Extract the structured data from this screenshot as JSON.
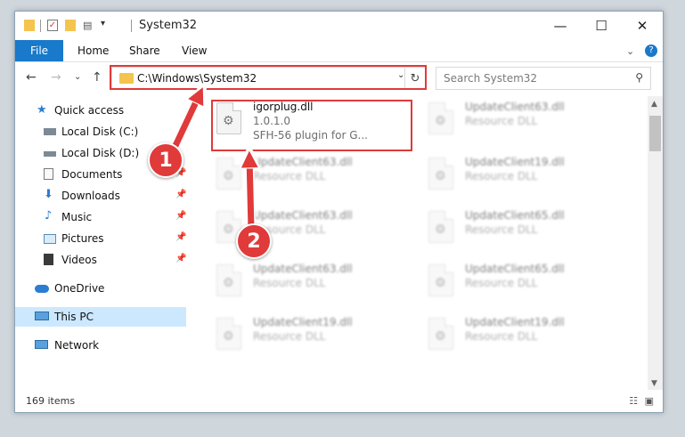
{
  "window": {
    "title": "System32"
  },
  "ribbon": {
    "file": "File",
    "home": "Home",
    "share": "Share",
    "view": "View"
  },
  "nav": {
    "address": "C:\\Windows\\System32",
    "search_placeholder": "Search System32"
  },
  "sidebar": {
    "items": [
      {
        "label": "Quick access"
      },
      {
        "label": "Local Disk (C:)"
      },
      {
        "label": "Local Disk (D:)"
      },
      {
        "label": "Documents"
      },
      {
        "label": "Downloads"
      },
      {
        "label": "Music"
      },
      {
        "label": "Pictures"
      },
      {
        "label": "Videos"
      },
      {
        "label": "OneDrive"
      },
      {
        "label": "This PC"
      },
      {
        "label": "Network"
      }
    ]
  },
  "files": [
    {
      "name": "igorplug.dll",
      "line1": "1.0.1.0",
      "line2": "SFH-56 plugin for G..."
    },
    {
      "name": "UpdateClient63.dll",
      "line1": "Resource DLL"
    },
    {
      "name": "UpdateClient63.dll",
      "line1": "Resource DLL"
    },
    {
      "name": "UpdateClient19.dll",
      "line1": "Resource DLL"
    },
    {
      "name": "UpdateClient63.dll",
      "line1": "Resource DLL"
    },
    {
      "name": "UpdateClient65.dll",
      "line1": "Resource DLL"
    },
    {
      "name": "UpdateClient63.dll",
      "line1": "Resource DLL"
    },
    {
      "name": "UpdateClient65.dll",
      "line1": "Resource DLL"
    },
    {
      "name": "UpdateClient19.dll",
      "line1": "Resource DLL"
    },
    {
      "name": "UpdateClient19.dll",
      "line1": "Resource DLL"
    }
  ],
  "status": {
    "count": "169 items"
  },
  "annotations": {
    "step1": "1",
    "step2": "2"
  },
  "colors": {
    "accent": "#1979ca",
    "highlight": "#e03a3a",
    "selection": "#cce8ff"
  }
}
